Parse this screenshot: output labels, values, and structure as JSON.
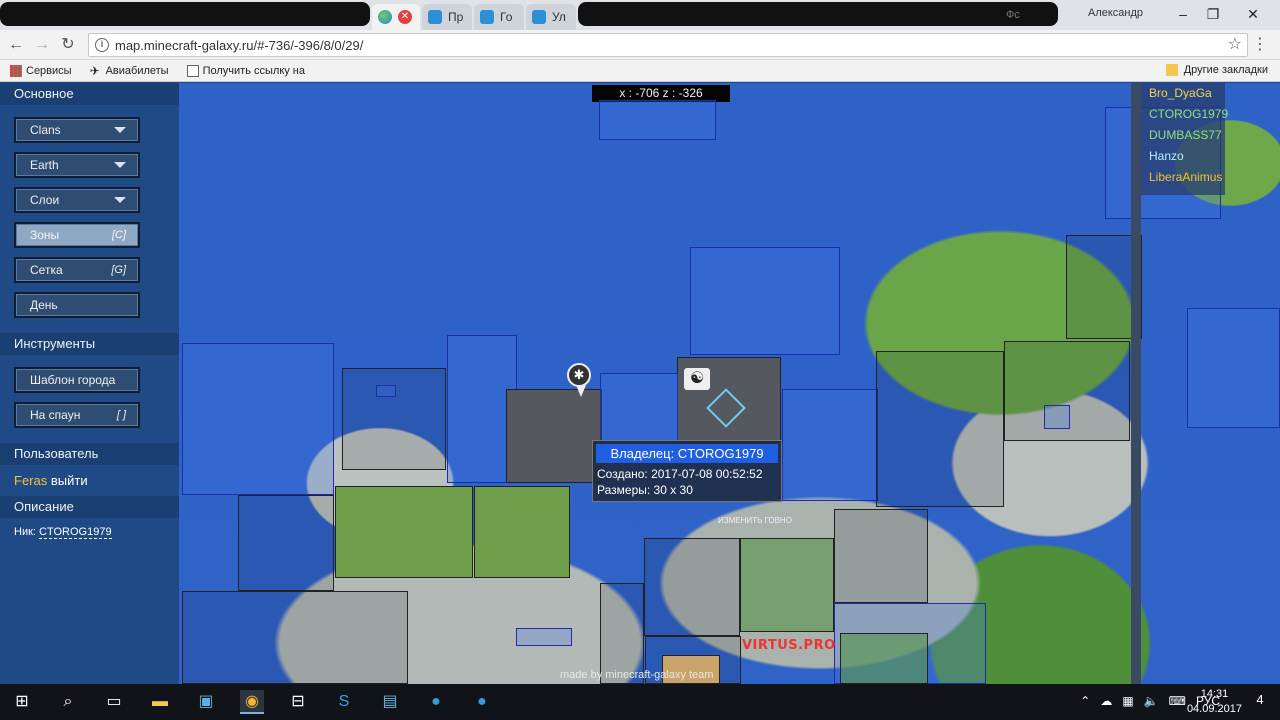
{
  "browser": {
    "tabs": [
      {
        "label": "",
        "icon": "globe-icon"
      },
      {
        "label": "Пр",
        "icon": "minecraft-icon"
      },
      {
        "label": "Го",
        "icon": "minecraft-icon"
      },
      {
        "label": "Ул",
        "icon": "minecraft-icon"
      }
    ],
    "partial_tab_text": "Фс",
    "user": "Александр",
    "url": "map.minecraft-galaxy.ru/#-736/-396/8/0/29/",
    "bookmarks": [
      {
        "label": "Сервисы",
        "icon": "apps-icon"
      },
      {
        "label": "Авиабилеты",
        "icon": "plane-icon"
      },
      {
        "label": "Получить ссылку на",
        "icon": "page-icon"
      }
    ],
    "other_bookmarks": "Другие закладки"
  },
  "left_panel": {
    "sections": {
      "main_title": "Основное",
      "tools_title": "Инструменты",
      "user_title": "Пользователь",
      "description_title": "Описание"
    },
    "main_buttons": [
      {
        "label": "Clans",
        "type": "dropdown"
      },
      {
        "label": "Earth",
        "type": "dropdown"
      },
      {
        "label": "Слои",
        "type": "dropdown"
      },
      {
        "label": "Зоны",
        "hotkey": "[C]",
        "active": true
      },
      {
        "label": "Сетка",
        "hotkey": "[G]"
      },
      {
        "label": "День"
      }
    ],
    "tool_buttons": [
      {
        "label": "Шаблон города"
      },
      {
        "label": "На спаун",
        "hotkey": "[ ]"
      }
    ],
    "user": {
      "name": "Feras",
      "logout": "выйти"
    },
    "description": {
      "nick_label": "Ник:",
      "nick_value": "CTOROG1979"
    }
  },
  "map": {
    "coords": "x : -706 z : -326",
    "popup": {
      "owner": "Владелец: CTOROG1979",
      "created": "Создано: 2017-07-08 00:52:52",
      "size": "Размеры: 30 x 30"
    },
    "label_virtus": "VIRTUS.PRO",
    "label_change": "ИЗМЕНИТЬ ГОВНО",
    "watermark": "made by minecraft-galaxy team"
  },
  "players": [
    {
      "name": "Bro_DyaGa",
      "color": "#f5d547"
    },
    {
      "name": "CTOROG1979",
      "color": "#8fe27a"
    },
    {
      "name": "DUMBASS77",
      "color": "#8fe27a"
    },
    {
      "name": "Hanzo",
      "color": "#b9f0ff"
    },
    {
      "name": "LiberaAnimus",
      "color": "#f5c332"
    }
  ],
  "taskbar": {
    "language": "РУС",
    "time": "14:31",
    "date": "04.09.2017",
    "notifications": "4",
    "apps": [
      "start-icon",
      "search-icon",
      "task-view-icon",
      "explorer-icon",
      "app-icon",
      "chrome-icon",
      "store-icon",
      "skype-icon",
      "app-icon",
      "minecraft-launcher-icon",
      "minecraft-launcher-icon"
    ]
  }
}
